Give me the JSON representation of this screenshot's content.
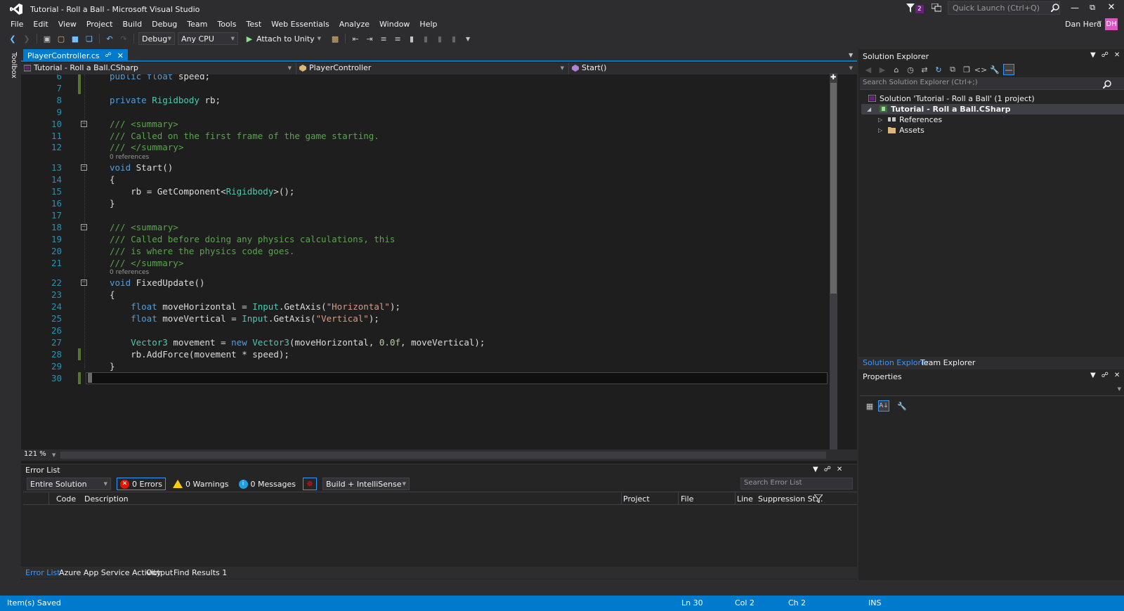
{
  "window": {
    "title": "Tutorial - Roll a Ball - Microsoft Visual Studio",
    "notification_count": "2",
    "quick_launch_placeholder": "Quick Launch (Ctrl+Q)",
    "user_name": "Dan Herd",
    "user_initials": "DH"
  },
  "menu": [
    "File",
    "Edit",
    "View",
    "Project",
    "Build",
    "Debug",
    "Team",
    "Tools",
    "Test",
    "Web Essentials",
    "Analyze",
    "Window",
    "Help"
  ],
  "toolbar": {
    "config": "Debug",
    "platform": "Any CPU",
    "run_label": "Attach to Unity"
  },
  "toolbox_label": "Toolbox",
  "editor": {
    "tab_label": "PlayerController.cs",
    "nav_project": "Tutorial - Roll a Ball.CSharp",
    "nav_class": "PlayerController",
    "nav_member": "Start()",
    "zoom": "121 %",
    "lines": [
      {
        "n": "6",
        "code": "public float speed;"
      },
      {
        "n": "7",
        "code": ""
      },
      {
        "n": "8",
        "code": "private Rigidbody rb;"
      },
      {
        "n": "9",
        "code": ""
      },
      {
        "n": "10",
        "code": "/// <summary>"
      },
      {
        "n": "11",
        "code": "/// Called on the first frame of the game starting."
      },
      {
        "n": "12",
        "code": "/// </summary>"
      },
      {
        "refs": "0 references"
      },
      {
        "n": "13",
        "code": "void Start()"
      },
      {
        "n": "14",
        "code": "{"
      },
      {
        "n": "15",
        "code": "    rb = GetComponent<Rigidbody>();"
      },
      {
        "n": "16",
        "code": "}"
      },
      {
        "n": "17",
        "code": ""
      },
      {
        "n": "18",
        "code": "/// <summary>"
      },
      {
        "n": "19",
        "code": "/// Called before doing any physics calculations, this"
      },
      {
        "n": "20",
        "code": "/// is where the physics code goes."
      },
      {
        "n": "21",
        "code": "/// </summary>"
      },
      {
        "refs": "0 references"
      },
      {
        "n": "22",
        "code": "void FixedUpdate()"
      },
      {
        "n": "23",
        "code": "{"
      },
      {
        "n": "24",
        "code": "    float moveHorizontal = Input.GetAxis(\"Horizontal\");"
      },
      {
        "n": "25",
        "code": "    float moveVertical = Input.GetAxis(\"Vertical\");"
      },
      {
        "n": "26",
        "code": ""
      },
      {
        "n": "27",
        "code": "    Vector3 movement = new Vector3(moveHorizontal, 0.0f, moveVertical);"
      },
      {
        "n": "28",
        "code": "    rb.AddForce(movement * speed);"
      },
      {
        "n": "29",
        "code": "}"
      },
      {
        "n": "30",
        "code": ""
      }
    ]
  },
  "error_list": {
    "title": "Error List",
    "scope": "Entire Solution",
    "errors": "0 Errors",
    "warnings": "0 Warnings",
    "messages": "0 Messages",
    "build_filter": "Build + IntelliSense",
    "search_placeholder": "Search Error List",
    "columns": [
      "Code",
      "Description",
      "Project",
      "File",
      "Line",
      "Suppression St..."
    ]
  },
  "bottom_tabs": [
    "Error List",
    "Azure App Service Activity",
    "Output",
    "Find Results 1"
  ],
  "solution_explorer": {
    "title": "Solution Explorer",
    "search_placeholder": "Search Solution Explorer (Ctrl+;)",
    "solution": "Solution 'Tutorial - Roll a Ball' (1 project)",
    "project": "Tutorial - Roll a Ball.CSharp",
    "references": "References",
    "assets": "Assets",
    "tabs": [
      "Solution Explorer",
      "Team Explorer"
    ]
  },
  "properties": {
    "title": "Properties"
  },
  "status": {
    "message": "Item(s) Saved",
    "ln": "Ln 30",
    "col": "Col 2",
    "ch": "Ch 2",
    "mode": "INS"
  },
  "colors": {
    "accent": "#007acc",
    "keyword": "#569cd6",
    "comment": "#57a64a",
    "type": "#4ec9b0",
    "string": "#d69d85",
    "line_number": "#2b91af"
  }
}
